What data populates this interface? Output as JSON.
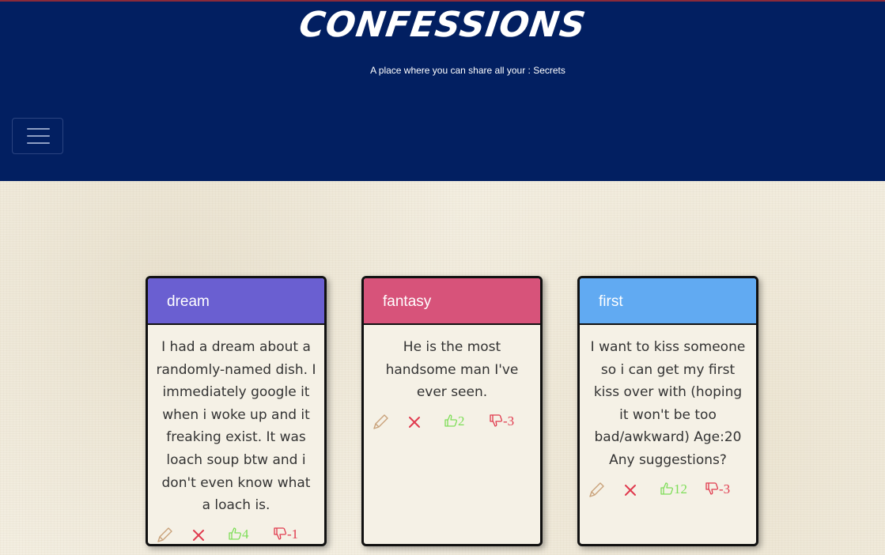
{
  "header": {
    "title": "CONFESSIONS",
    "tagline": "A place where you can share all your : Secrets",
    "menu_icon": "hamburger-icon"
  },
  "colors": {
    "header_bg": "#021f61",
    "dream": "#6a5fd1",
    "fantasy": "#d7537a",
    "first": "#61aaf2",
    "like": "#7ede58",
    "dislike": "#e03a4e"
  },
  "cards": [
    {
      "category": "dream",
      "text": "I had a dream about a randomly-named dish. I immediately google it when i woke up and it freaking exist. It was loach soup btw and i don't even know what a loach is.",
      "likes": "4",
      "dislikes": "-1"
    },
    {
      "category": "fantasy",
      "text": "He is the most handsome man I've ever seen.",
      "likes": "2",
      "dislikes": "-3"
    },
    {
      "category": "first",
      "text": "I want to kiss someone so i can get my first kiss over with (hoping it won't be too bad/awkward) Age:20 Any suggestions?",
      "likes": "12",
      "dislikes": "-3"
    }
  ]
}
